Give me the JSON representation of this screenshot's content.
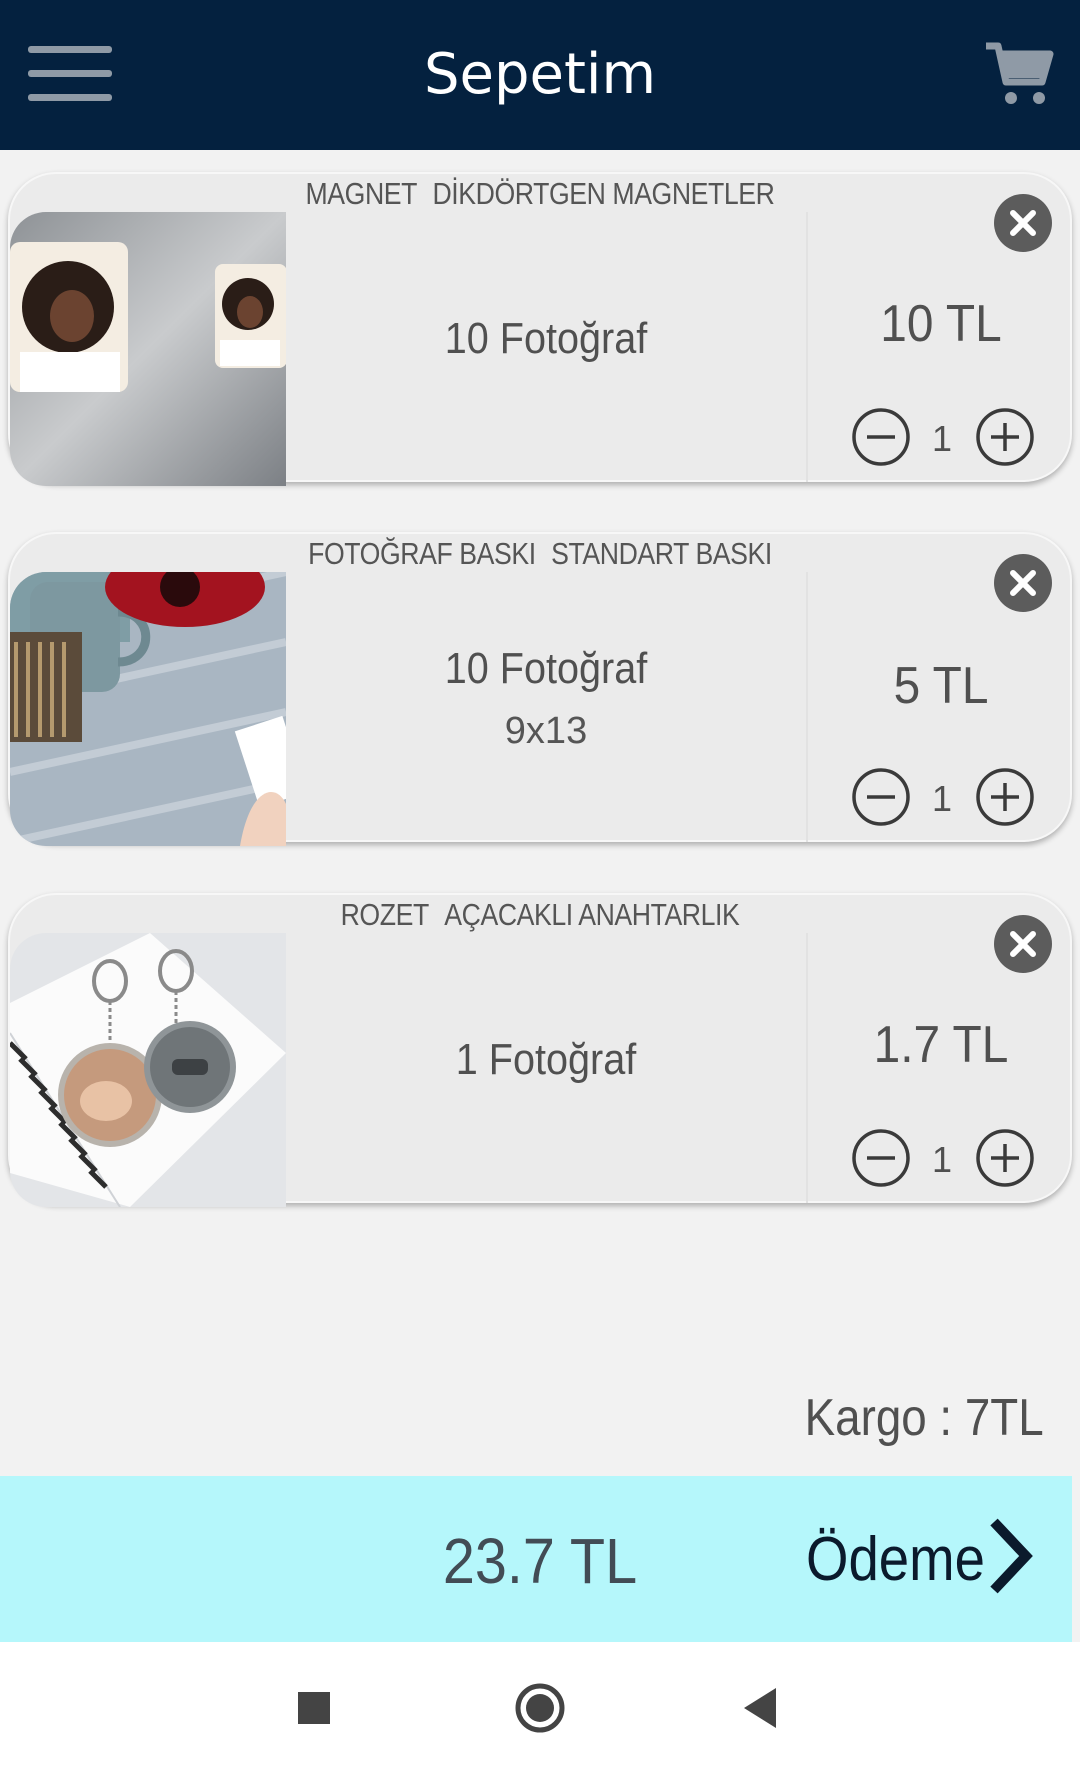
{
  "header": {
    "title": "Sepetim"
  },
  "items": [
    {
      "category": "MAGNET",
      "subcategory": "DİKDÖRTGEN MAGNETLER",
      "photo_count": "10 Fotoğraf",
      "size": "",
      "price": "10 TL",
      "quantity": "1"
    },
    {
      "category": "FOTOĞRAF BASKI",
      "subcategory": "STANDART BASKI",
      "photo_count": "10 Fotoğraf",
      "size": "9x13",
      "price": "5 TL",
      "quantity": "1"
    },
    {
      "category": "ROZET",
      "subcategory": "AÇACAKLI ANAHTARLIK",
      "photo_count": "1 Fotoğraf",
      "size": "",
      "price": "1.7 TL",
      "quantity": "1"
    }
  ],
  "shipping": "Kargo : 7TL",
  "total": "23.7 TL",
  "checkout": {
    "label": "Ödeme"
  },
  "colors": {
    "header_bg": "#04213f",
    "total_bar_bg": "#b5f7fb",
    "card_bg": "#ebebeb"
  }
}
